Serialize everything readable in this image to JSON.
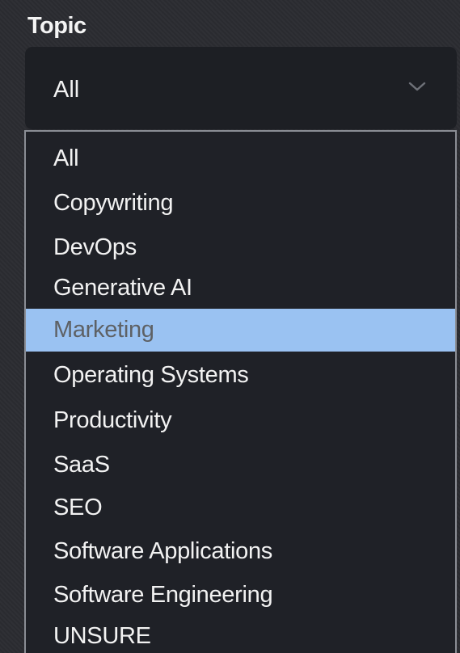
{
  "label": "Topic",
  "select": {
    "value": "All",
    "chevron_icon": "chevron-down-icon"
  },
  "options": [
    {
      "label": "All",
      "highlighted": false
    },
    {
      "label": "Copywriting",
      "highlighted": false
    },
    {
      "label": "DevOps",
      "highlighted": false
    },
    {
      "label": "Generative AI",
      "highlighted": false
    },
    {
      "label": "Marketing",
      "highlighted": true
    },
    {
      "label": "Operating Systems",
      "highlighted": false
    },
    {
      "label": "Productivity",
      "highlighted": false
    },
    {
      "label": "SaaS",
      "highlighted": false
    },
    {
      "label": "SEO",
      "highlighted": false
    },
    {
      "label": "Software Applications",
      "highlighted": false
    },
    {
      "label": "Software Engineering",
      "highlighted": false
    },
    {
      "label": "UNSURE",
      "highlighted": false
    }
  ],
  "colors": {
    "background": "#2b2c31",
    "select_background": "#1d1f24",
    "list_background": "#1f2127",
    "highlight": "#9ac2f2",
    "text": "#f2f2f2"
  }
}
